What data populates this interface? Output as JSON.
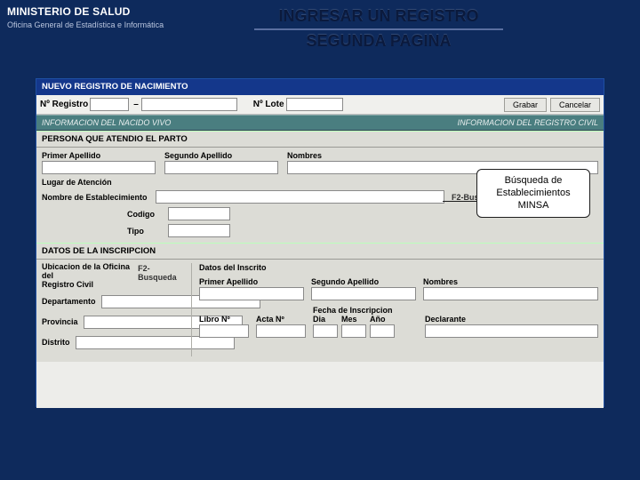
{
  "banner": {
    "ministry": "MINISTERIO DE SALUD",
    "office": "Oficina General de Estadística e Informática",
    "title_line_1": "INGRESAR UN REGISTRO",
    "title_line_2": "SEGUNDA PAGINA"
  },
  "window": {
    "title": "NUEVO REGISTRO DE NACIMIENTO"
  },
  "regbar": {
    "registro_label": "Nº Registro",
    "lote_label": "Nº Lote",
    "btn_grabar": "Grabar",
    "btn_cancelar": "Cancelar"
  },
  "sections": {
    "info_nacido": "INFORMACION DEL NACIDO VIVO",
    "info_civil": "INFORMACION DEL REGISTRO CIVIL",
    "persona_parto": "PERSONA QUE ATENDIO EL PARTO",
    "datos_inscripcion": "DATOS DE LA INSCRIPCION"
  },
  "persona": {
    "primer_apellido": "Primer Apellido",
    "segundo_apellido": "Segundo Apellido",
    "nombres": "Nombres",
    "lugar_atencion": "Lugar de Atención",
    "nombre_estab": "Nombre de Establecimiento",
    "f2_busqueda": "F2-Busqueda",
    "codigo": "Codigo",
    "tipo": "Tipo"
  },
  "inscripcion": {
    "ubic_label_1": "Ubicacion de la Oficina del",
    "ubic_label_2": "Registro Civil",
    "f2_busqueda": "F2-Busqueda",
    "departamento": "Departamento",
    "provincia": "Provincia",
    "distrito": "Distrito",
    "datos_inscrito": "Datos del Inscrito",
    "primer_apellido": "Primer Apellido",
    "segundo_apellido": "Segundo Apellido",
    "nombres": "Nombres",
    "libro": "Libro Nº",
    "acta": "Acta Nº",
    "fecha_label": "Fecha de Inscripcion",
    "dia": "Dia",
    "mes": "Mes",
    "ano": "Año",
    "declarante": "Declarante"
  },
  "callout": {
    "line1": "Búsqueda de",
    "line2": "Establecimientos",
    "line3": "MINSA"
  }
}
